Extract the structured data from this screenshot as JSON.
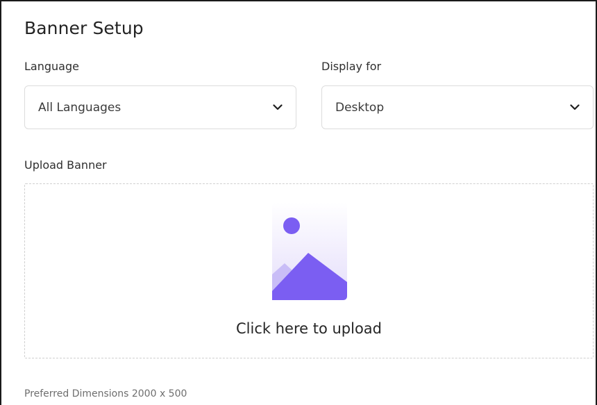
{
  "section": {
    "title": "Banner Setup"
  },
  "language": {
    "label": "Language",
    "selected": "All Languages",
    "icon": "chevron-down-icon"
  },
  "display": {
    "label": "Display for",
    "selected": "Desktop",
    "icon": "chevron-down-icon"
  },
  "upload": {
    "label": "Upload Banner",
    "cta": "Click here to upload",
    "icon": "image-placeholder-icon",
    "hint": "Preferred Dimensions 2000 x 500"
  },
  "colors": {
    "accent": "#7b5ef2",
    "border": "#dcdcdc",
    "dashed_border": "#cfcfcf"
  }
}
